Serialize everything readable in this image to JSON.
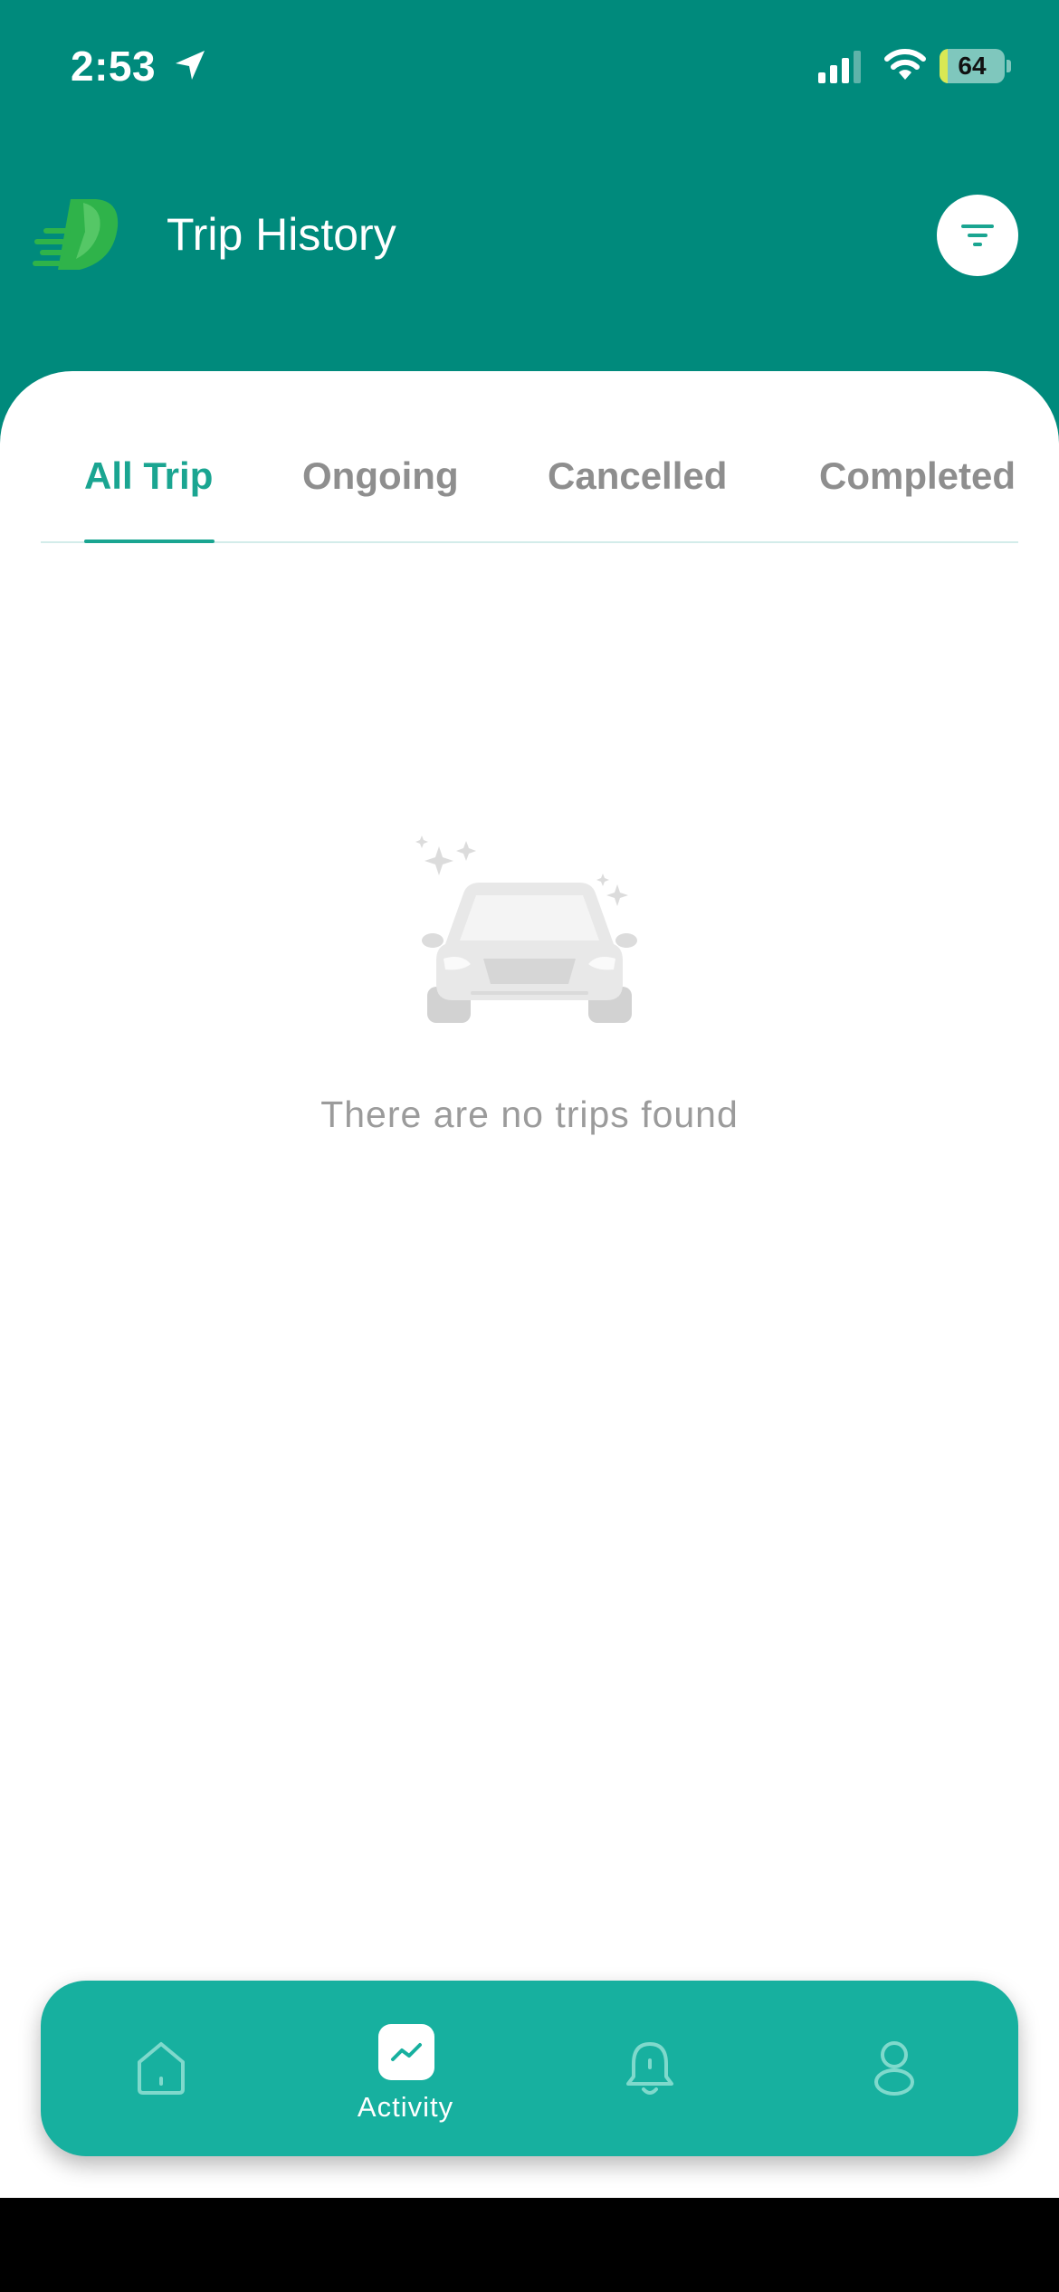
{
  "status_bar": {
    "time": "2:53",
    "battery": "64",
    "battery_level_percent": 64,
    "icons": [
      "location-arrow-icon",
      "cellular-signal-icon",
      "wifi-icon",
      "battery-charging-icon"
    ]
  },
  "header": {
    "title": "Trip History",
    "logo": "d-leaf-logo",
    "filter_icon": "filter-icon"
  },
  "tabs": [
    {
      "label": "All Trip",
      "active": true
    },
    {
      "label": "Ongoing",
      "active": false
    },
    {
      "label": "Cancelled",
      "active": false
    },
    {
      "label": "Completed",
      "active": false
    }
  ],
  "empty_state": {
    "illustration": "car-sparkle-illustration",
    "message": "There are no trips found"
  },
  "bottom_nav": {
    "items": [
      {
        "icon": "home-icon",
        "label": "",
        "active": false
      },
      {
        "icon": "activity-chart-icon",
        "label": "Activity",
        "active": true
      },
      {
        "icon": "bell-icon",
        "label": "",
        "active": false
      },
      {
        "icon": "profile-icon",
        "label": "",
        "active": false
      }
    ]
  },
  "colors": {
    "header_background": "#008a7c",
    "accent": "#1aa591",
    "nav_background": "#17b09f",
    "inactive_tab": "#8e8e8e"
  }
}
